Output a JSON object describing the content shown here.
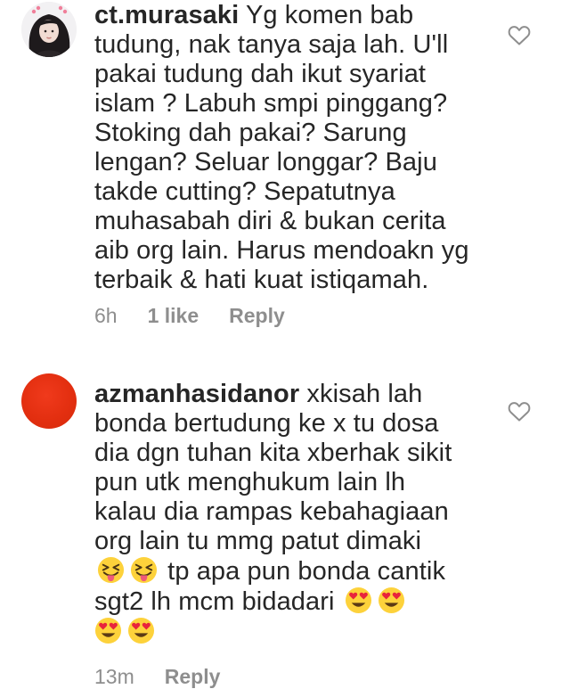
{
  "comments": [
    {
      "username": "ct.murasaki",
      "text": "Yg komen bab\ntudung, nak tanya saja lah. U'll\npakai tudung dah ikut syariat\nislam ? Labuh smpi pinggang?\nStoking dah pakai? Sarung\nlengan? Seluar longgar? Baju\ntakde cutting? Sepatutnya\nmuhasabah diri & bukan cerita\naib org lain. Harus mendoakn yg\nterbaik & hati kuat istiqamah.",
      "time": "6h",
      "likes": "1 like",
      "reply_label": "Reply",
      "avatar_icon": "profile-photo",
      "like_icon": "heart-outline-icon"
    },
    {
      "username": "azmanhasidanor",
      "text_part1": "xkisah lah\nbonda bertudung ke x tu dosa\ndia dgn tuhan kita xberhak sikit\npun utk menghukum lain lh\nkalau dia rampas kebahagiaan\norg lain tu mmg patut dimaki\n",
      "text_part2": " tp apa pun bonda cantik\nsgt2 lh mcm bidadari ",
      "emoji_squint_tongue": "😝",
      "emoji_heart_eyes": "😍",
      "time": "13m",
      "reply_label": "Reply",
      "avatar_color": "#e3300f",
      "like_icon": "heart-outline-icon"
    }
  ]
}
